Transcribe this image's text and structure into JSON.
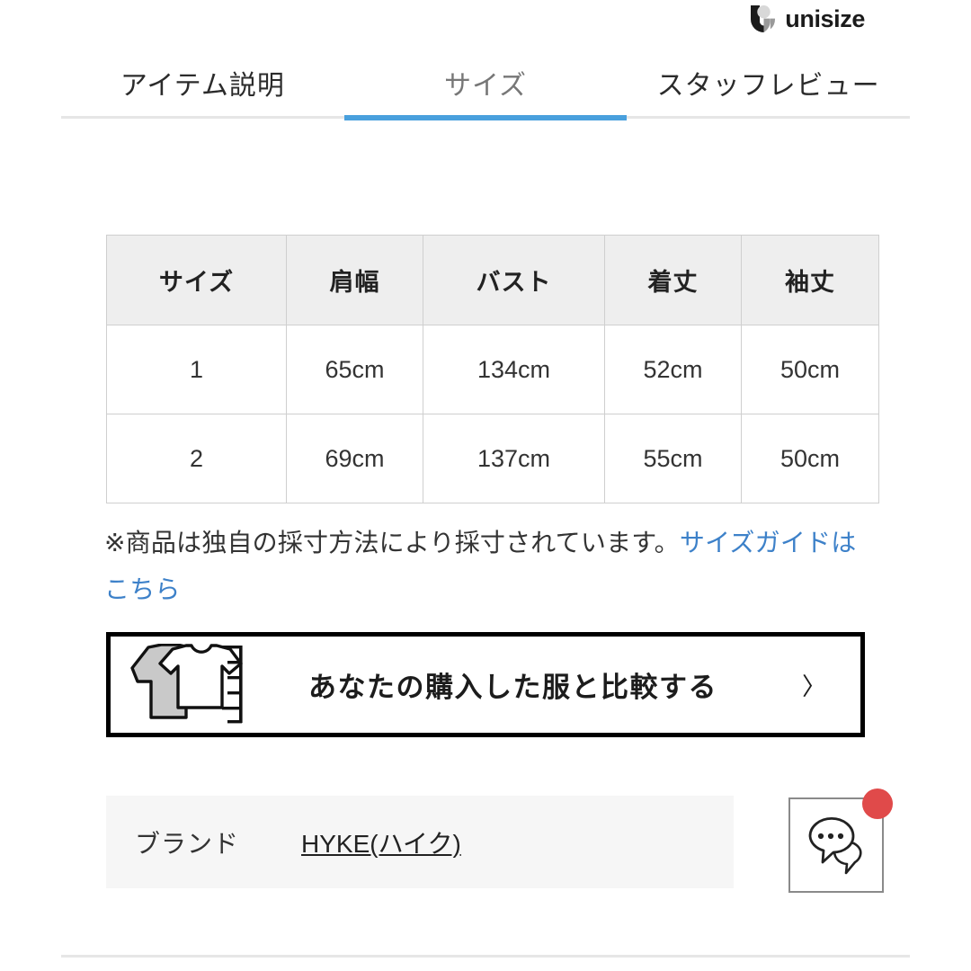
{
  "logo": {
    "text": "unisize",
    "mark_colors": {
      "dark": "#1b1b1b",
      "light": "#d8d8d8",
      "mid": "#9a9a9a"
    }
  },
  "tabs": [
    {
      "label": "アイテム説明",
      "active": false
    },
    {
      "label": "サイズ",
      "active": true
    },
    {
      "label": "スタッフレビュー",
      "active": false
    }
  ],
  "accent_colors": {
    "tab_underline": "#49a0dd",
    "link": "#3d81c9",
    "badge": "#e04a4a"
  },
  "size_table": {
    "headers": [
      "サイズ",
      "肩幅",
      "バスト",
      "着丈",
      "袖丈"
    ],
    "rows": [
      [
        "1",
        "65cm",
        "134cm",
        "52cm",
        "50cm"
      ],
      [
        "2",
        "69cm",
        "137cm",
        "55cm",
        "50cm"
      ]
    ]
  },
  "note": {
    "text": "※商品は独自の採寸方法により採寸されています。",
    "link_text": "サイズガイドはこちら"
  },
  "compare_button": {
    "label": "あなたの購入した服と比較する",
    "chevron": "〉",
    "icon": "two-shirts-ruler-icon"
  },
  "brand": {
    "label": "ブランド",
    "value": "HYKE(ハイク)"
  },
  "chat": {
    "icon": "speech-bubbles-icon",
    "has_notification": true
  }
}
